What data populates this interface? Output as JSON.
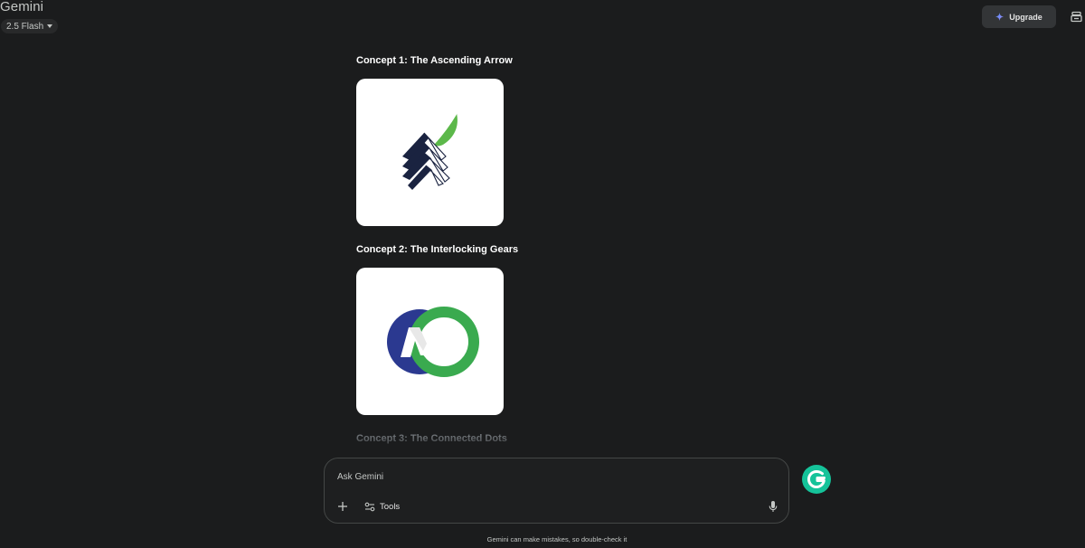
{
  "header": {
    "app_title": "Gemini",
    "model_label": "2.5 Flash",
    "upgrade_label": "Upgrade"
  },
  "concepts": [
    {
      "title": "Concept 1: The Ascending Arrow",
      "logo": "ascending-arrow-leaf-logo"
    },
    {
      "title": "Concept 2: The Interlocking Gears",
      "logo": "interlocking-m-logo"
    },
    {
      "title": "Concept 3: The Connected Dots"
    }
  ],
  "input": {
    "placeholder": "Ask Gemini",
    "tools_label": "Tools"
  },
  "footer": {
    "disclaimer": "Gemini can make mistakes, so double-check it"
  },
  "colors": {
    "background": "#1b1c1d",
    "logo_navy": "#1a2340",
    "logo_green": "#4cae4c",
    "logo_blue": "#2b3990",
    "logo_ring_green": "#3aaa4f",
    "grammarly_green": "#15c39a"
  }
}
